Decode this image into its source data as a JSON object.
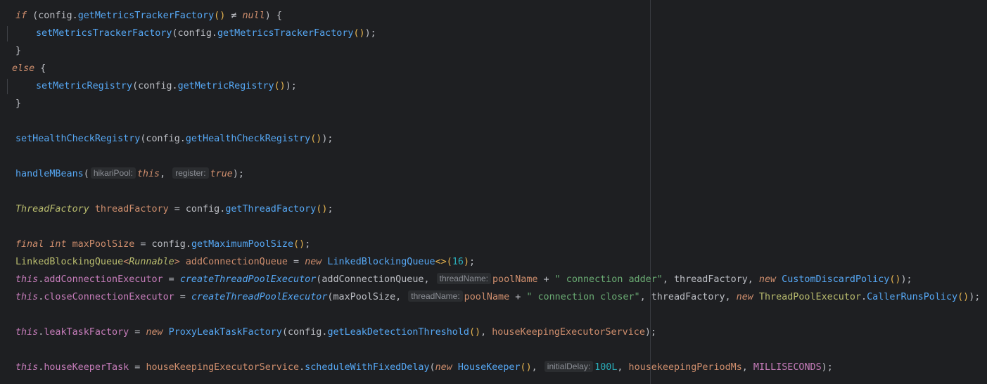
{
  "code": {
    "l1": {
      "kw_if": "if",
      "t1": " (config.",
      "fn": "getMetricsTrackerFactory",
      "p": "()",
      "op": " ≠ ",
      "kw_null": "null",
      "t2": ") {"
    },
    "l2": {
      "fn": "setMetricsTrackerFactory",
      "t1": "(config.",
      "fn2": "getMetricsTrackerFactory",
      "p": "()",
      "t2": ");"
    },
    "l3": {
      "t": "}"
    },
    "l4": {
      "kw_else": "else",
      "t": " {"
    },
    "l5": {
      "fn": "setMetricRegistry",
      "t1": "(config.",
      "fn2": "getMetricRegistry",
      "p": "()",
      "t2": ");"
    },
    "l6": {
      "t": "}"
    },
    "l7": {
      "fn": "setHealthCheckRegistry",
      "t1": "(config.",
      "fn2": "getHealthCheckRegistry",
      "p": "()",
      "t2": ");"
    },
    "l8": {
      "fn": "handleMBeans",
      "t1": "(",
      "hint1": "hikariPool:",
      "kw_this": "this",
      "t2": ",",
      "hint2": "register:",
      "kw_true": "true",
      "t3": ");"
    },
    "l9": {
      "type": "ThreadFactory",
      "var": " threadFactory",
      "t1": " = config.",
      "fn": "getThreadFactory",
      "p": "()",
      "t2": ";"
    },
    "l10": {
      "kw_final": "final",
      "kw_int": " int",
      "var": " maxPoolSize",
      "t1": " = config.",
      "fn": "getMaximumPoolSize",
      "p": "()",
      "t2": ";"
    },
    "l11": {
      "type": "LinkedBlockingQueue",
      "g1": "<",
      "gtype": "Runnable",
      "g2": ">",
      "var": " addConnectionQueue",
      "t1": " = ",
      "kw_new": "new",
      "fn": " LinkedBlockingQueue",
      "diamond": "<>",
      "p1": "(",
      "num": "16",
      "p2": ")",
      "t2": ";"
    },
    "l12": {
      "kw_this": "this",
      "t1": ".",
      "field": "addConnectionExecutor",
      "t2": " = ",
      "fn": "createThreadPoolExecutor",
      "t3": "(addConnectionQueue,",
      "hint": "threadName:",
      "var": "poolName",
      "t4": " + ",
      "str": "\" connection adder\"",
      "t5": ", threadFactory, ",
      "kw_new": "new",
      "fn2": " CustomDiscardPolicy",
      "p": "()",
      "t6": ");"
    },
    "l13": {
      "kw_this": "this",
      "t1": ".",
      "field": "closeConnectionExecutor",
      "t2": " = ",
      "fn": "createThreadPoolExecutor",
      "t3": "(maxPoolSize,",
      "hint": "threadName:",
      "var": "poolName",
      "t4": " + ",
      "str": "\" connection closer\"",
      "t5": ", threadFactory, ",
      "kw_new": "new",
      "cls": " ThreadPoolExecutor",
      "t6": ".",
      "fn2": "CallerRunsPolicy",
      "p": "()",
      "t7": ");"
    },
    "l14": {
      "kw_this": "this",
      "t1": ".",
      "field": "leakTaskFactory",
      "t2": " = ",
      "kw_new": "new",
      "fn": " ProxyLeakTaskFactory",
      "t3": "(config.",
      "fn2": "getLeakDetectionThreshold",
      "p": "()",
      "t4": ", ",
      "var": "houseKeepingExecutorService",
      "t5": ");"
    },
    "l15": {
      "kw_this": "this",
      "t1": ".",
      "field": "houseKeeperTask",
      "t2": " = ",
      "var": "houseKeepingExecutorService",
      "t3": ".",
      "fn": "scheduleWithFixedDelay",
      "t4": "(",
      "kw_new": "new",
      "fn2": " HouseKeeper",
      "p": "()",
      "t5": ",",
      "hint": "initialDelay:",
      "num": "100L",
      "t6": ", ",
      "var2": "housekeepingPeriodMs",
      "t7": ", ",
      "const": "MILLISECONDS",
      "t8": ");"
    }
  }
}
